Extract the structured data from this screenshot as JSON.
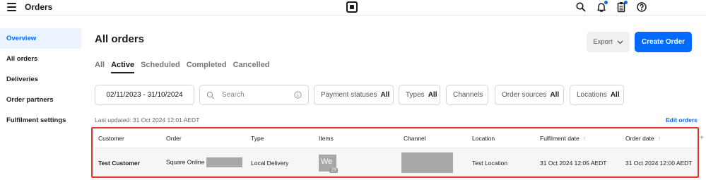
{
  "topbar": {
    "title": "Orders",
    "icons": [
      "menu-icon",
      "square-logo-icon",
      "search-icon",
      "bell-icon",
      "clipboard-icon",
      "help-icon"
    ],
    "accent": "#006aff"
  },
  "sidebar": {
    "items": [
      {
        "label": "Overview",
        "active": true
      },
      {
        "label": "All orders",
        "active": false
      },
      {
        "label": "Deliveries",
        "active": false
      },
      {
        "label": "Order partners",
        "active": false
      },
      {
        "label": "Fulfilment settings",
        "active": false
      }
    ]
  },
  "main": {
    "title": "All orders",
    "export_label": "Export",
    "create_label": "Create Order",
    "tabs": [
      {
        "label": "All",
        "active": false
      },
      {
        "label": "Active",
        "active": true
      },
      {
        "label": "Scheduled",
        "active": false
      },
      {
        "label": "Completed",
        "active": false
      },
      {
        "label": "Cancelled",
        "active": false
      }
    ],
    "filters": {
      "date_range": "02/11/2023 - 31/10/2024",
      "search_placeholder": "Search",
      "payment_statuses": {
        "label": "Payment statuses",
        "value": "All"
      },
      "types": {
        "label": "Types",
        "value": "All"
      },
      "channels": {
        "label": "Channels"
      },
      "order_sources": {
        "label": "Order sources",
        "value": "All"
      },
      "locations": {
        "label": "Locations",
        "value": "All"
      }
    },
    "last_updated": "Last updated: 31 Oct 2024 12:01 AEDT",
    "edit_orders": "Edit orders"
  },
  "table": {
    "columns": [
      "Customer",
      "Order",
      "Type",
      "Items",
      "Channel",
      "Location",
      "Fulfilment date",
      "Order date"
    ],
    "rows": [
      {
        "customer": "Test Customer",
        "order": "Square Online",
        "type": "Local Delivery",
        "items_thumb": "We",
        "items_count": "25",
        "location": "Test Location",
        "fulfilment_date": "31 Oct 2024 12:05 AEDT",
        "order_date": "31 Oct 2024 12:00 AEDT"
      }
    ]
  },
  "colors": {
    "primary": "#006aff",
    "highlight": "#e8302a",
    "sidebar_active_bg": "#eaf3ff"
  }
}
